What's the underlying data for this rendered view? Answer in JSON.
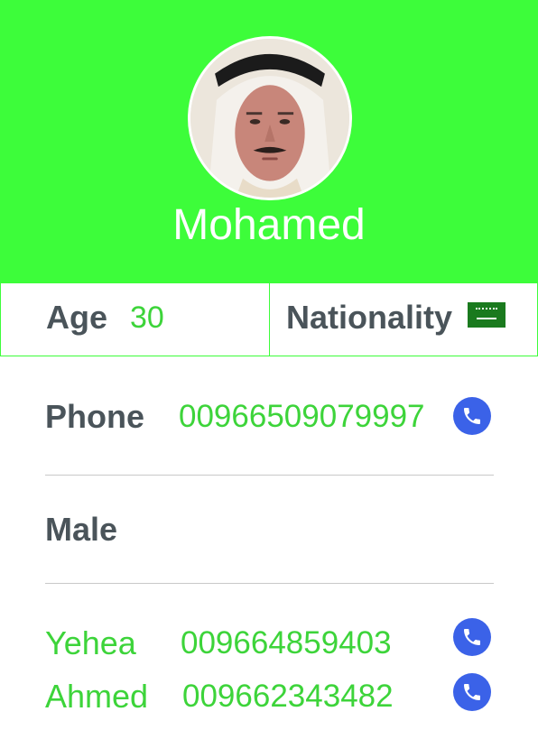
{
  "profile": {
    "name": "Mohamed",
    "avatar_icon": "profile-photo",
    "header_color": "#3dfd3a"
  },
  "info": {
    "age_label": "Age",
    "age_value": "30",
    "nationality_label": "Nationality",
    "nationality_flag_icon": "saudi-arabia-flag-icon"
  },
  "phone": {
    "label": "Phone",
    "value": "00966509079997",
    "call_icon": "phone-icon"
  },
  "gender": "Male",
  "contacts": [
    {
      "name": "Yehea",
      "phone": "009664859403",
      "call_icon": "phone-icon"
    },
    {
      "name": "Ahmed",
      "phone": "009662343482",
      "call_icon": "phone-icon"
    }
  ],
  "colors": {
    "accent_green": "#3dfd3a",
    "text_green": "#3dd43a",
    "label_gray": "#4a545a",
    "call_blue": "#3b62e8"
  }
}
